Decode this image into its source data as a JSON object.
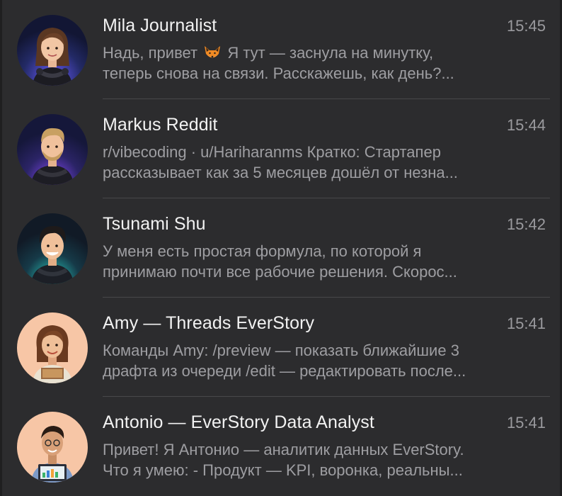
{
  "chats": [
    {
      "name": "Mila Journalist",
      "time": "15:45",
      "preview_line1_before": "Надь, привет",
      "preview_emoji": "fox-face-emoji",
      "preview_line1_after": "Я тут — заснула на минутку,",
      "preview_line2": "теперь снова на связи. Расскажешь, как день?..."
    },
    {
      "name": "Markus Reddit",
      "time": "15:44",
      "preview_line1": "r/vibecoding · u/Hariharanms  Кратко: Стартапер",
      "preview_line2": "рассказывает как за 5 месяцев дошёл от незна..."
    },
    {
      "name": "Tsunami Shu",
      "time": "15:42",
      "preview_line1": "У меня есть простая формула, по которой я",
      "preview_line2": "принимаю почти все рабочие решения. Скорос..."
    },
    {
      "name": "Amy — Threads EverStory",
      "time": "15:41",
      "preview_line1": "Команды Amy:  /preview — показать ближайшие 3",
      "preview_line2": "драфта из очереди /edit — редактировать после..."
    },
    {
      "name": "Antonio — EverStory Data Analyst",
      "time": "15:41",
      "preview_line1": "Привет! Я Антонио — аналитик данных EverStory.",
      "preview_line2": "Что я умею: - Продукт — KPI, воронка, реальны..."
    }
  ],
  "colors": {
    "background": "#2c2c2e",
    "name_text": "#f2f2f2",
    "secondary_text": "#9e9ea2",
    "divider": "#48484a"
  }
}
